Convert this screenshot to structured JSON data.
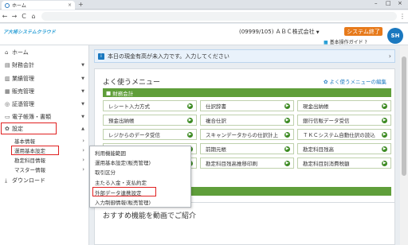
{
  "browser": {
    "tab_title": "ホーム",
    "tab_close": "×",
    "new_tab": "+",
    "win_min": "–",
    "win_max": "□",
    "win_close": "×",
    "nav_back": "←",
    "nav_forward": "→",
    "nav_reload": "C",
    "nav_home": "⌂",
    "menu": "⋮"
  },
  "header": {
    "logo_text": "ア大将システムクラウド",
    "company": "(09999/105) ＡＢＣ株式会社",
    "company_caret": "▼",
    "system_end": "システム終了",
    "guide_label": "基本操作ガイド",
    "guide_icon": "?",
    "avatar_text": "SH"
  },
  "sidebar": {
    "items": [
      {
        "icon": "home-icon",
        "label": "ホーム"
      },
      {
        "icon": "ledger-icon",
        "label": "財務会計"
      },
      {
        "icon": "chart-icon",
        "label": "業績管理"
      },
      {
        "icon": "cart-icon",
        "label": "販売管理"
      },
      {
        "icon": "coin-icon",
        "label": "証憑管理"
      },
      {
        "icon": "monitor-icon",
        "label": "電子帳簿・書類"
      },
      {
        "icon": "gear-icon",
        "label": "設定"
      }
    ],
    "sub_items": [
      "基本情報",
      "運用基本設定",
      "勘定科目情報",
      "マスター情報"
    ],
    "download": "ダウンロード"
  },
  "notice": {
    "text": "本日の現金有高が未入力です。入力してください"
  },
  "favorites": {
    "title": "よく使うメニュー",
    "edit": "よく使うメニューの編集",
    "category": "財務会計",
    "items": [
      "レシート入力方式",
      "仕訳辞書",
      "現金出納帳",
      "預金出納帳",
      "複合仕訳",
      "銀行信販データ受信",
      "レジからのデータ受信",
      "スキャンデータからの仕訳計上",
      "ＴＫＣシステム自動仕訳の読込",
      "",
      "前期元帳",
      "勘定科目残高",
      "",
      "勘定科目残高推移印刷",
      "勘定科目別消費税額"
    ]
  },
  "dropdown": {
    "items": [
      "利用機能範囲",
      "運用基本設定(販売管理)",
      "取引区分",
      "主たる入金・支払約定",
      "外部データ連携設定",
      "入力制御情報(販売管理)"
    ]
  },
  "recommend": {
    "title": "おすすめ機能を動画でご紹介"
  },
  "colors": {
    "accent": "#1a78bf",
    "category_green": "#5f9e3a",
    "system_end_orange": "#e77a1b",
    "highlight_red": "#e02020"
  }
}
